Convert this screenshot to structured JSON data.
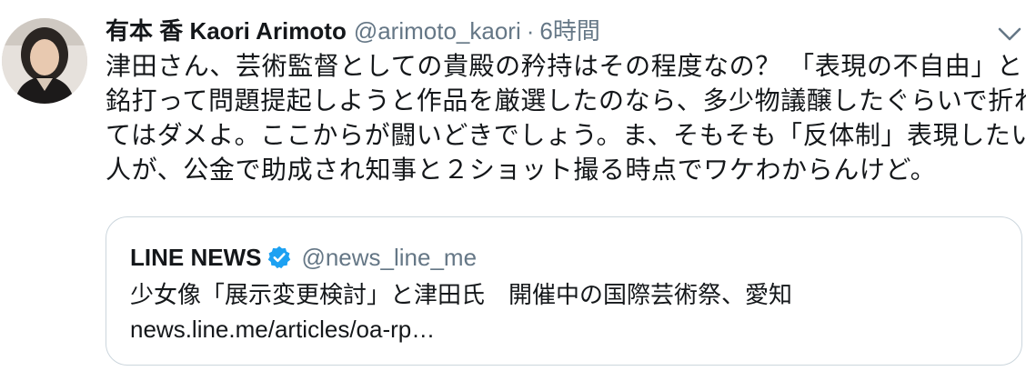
{
  "tweet": {
    "author": {
      "display_name": "有本 香 Kaori Arimoto",
      "handle": "@arimoto_kaori",
      "separator": "·",
      "time": "6時間"
    },
    "text_lines": [
      "津田さん、芸術監督としての貴殿の矜持はその程度なの？ 「表現の不自由」と",
      "銘打って問題提起しようと作品を厳選したのなら、多少物議醸したぐらいで折れ",
      "てはダメよ。ここからが闘いどきでしょう。ま、そもそも「反体制」表現したい",
      "人が、公金で助成され知事と２ショット撮る時点でワケわからんけど。"
    ],
    "caret_icon": "chevron-down-icon",
    "quote": {
      "name": "LINE NEWS",
      "verified_icon": "verified-badge-icon",
      "handle": "@news_line_me",
      "text": "少女像「展示変更検討」と津田氏　開催中の国際芸術祭、愛知",
      "link": "news.line.me/articles/oa-rp…"
    }
  },
  "colors": {
    "text": "#14171a",
    "secondary": "#657786",
    "border": "#ccd6dd",
    "verified": "#1da1f2"
  }
}
